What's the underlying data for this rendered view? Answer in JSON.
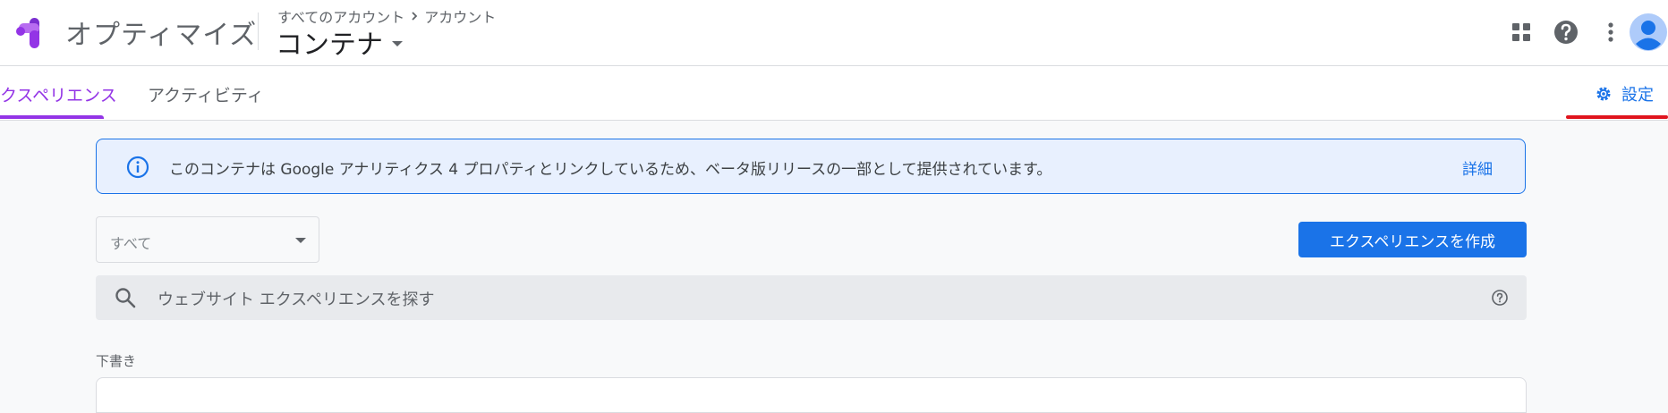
{
  "app": {
    "title": "オプティマイズ",
    "breadcrumb": [
      "すべてのアカウント",
      "アカウント"
    ],
    "container_name": "コンテナ"
  },
  "tabs": [
    {
      "label": "クスペリエンス",
      "active": true
    },
    {
      "label": "アクティビティ",
      "active": false
    }
  ],
  "settings": {
    "label": "設定"
  },
  "banner": {
    "text": "このコンテナは Google アナリティクス 4 プロパティとリンクしているため、ベータ版リリースの一部として提供されています。",
    "link": "詳細"
  },
  "filter": {
    "selected": "すべて"
  },
  "create_button": {
    "label": "エクスペリエンスを作成"
  },
  "search": {
    "placeholder": "ウェブサイト エクスペリエンスを探す"
  },
  "sections": [
    {
      "label": "下書き"
    }
  ],
  "colors": {
    "accent": "#9334e6",
    "primary": "#1a73e8",
    "banner_bg": "#e8f0fe",
    "highlight_underline": "#e0141e"
  },
  "icons": [
    "optimize-logo-icon",
    "apps-grid-icon",
    "help-icon",
    "more-vert-icon",
    "account-avatar-icon",
    "gear-icon",
    "info-icon",
    "search-icon",
    "help-outline-icon",
    "chevron-right-icon",
    "caret-down-icon"
  ]
}
